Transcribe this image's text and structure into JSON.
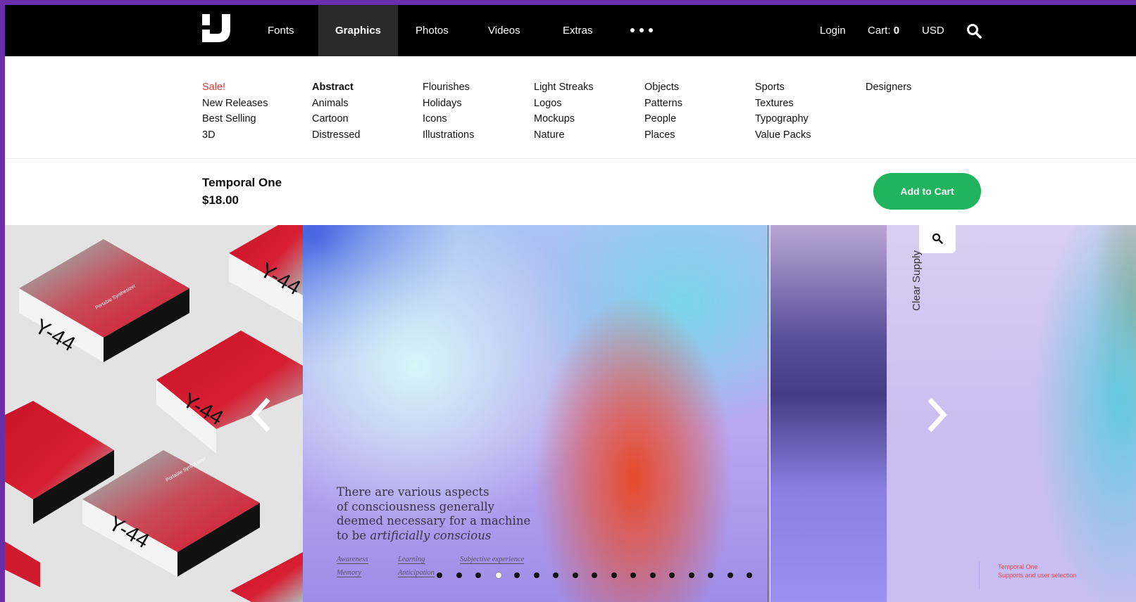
{
  "nav": {
    "links": [
      {
        "label": "Fonts",
        "active": false
      },
      {
        "label": "Graphics",
        "active": true
      },
      {
        "label": "Photos",
        "active": false
      },
      {
        "label": "Videos",
        "active": false
      },
      {
        "label": "Extras",
        "active": false
      }
    ],
    "login": "Login",
    "cart_label": "Cart:",
    "cart_count": "0",
    "currency": "USD"
  },
  "menu": {
    "col1": [
      "Sale!",
      "New Releases",
      "Best Selling",
      "3D"
    ],
    "col2": [
      "Abstract",
      "Animals",
      "Cartoon",
      "Distressed"
    ],
    "col3": [
      "Flourishes",
      "Holidays",
      "Icons",
      "Illustrations"
    ],
    "col4": [
      "Light Streaks",
      "Logos",
      "Mockups",
      "Nature"
    ],
    "col5": [
      "Objects",
      "Patterns",
      "People",
      "Places"
    ],
    "col6": [
      "Sports",
      "Textures",
      "Typography",
      "Value Packs"
    ],
    "col7": [
      "Designers"
    ]
  },
  "product": {
    "title": "Temporal One",
    "price": "$18.00",
    "add_to_cart": "Add to Cart"
  },
  "gallery": {
    "box_label": "Y-44",
    "box_sub": "Portable Synthesizer",
    "quote_lines": [
      "There are various aspects",
      "of consciousness generally",
      "deemed necessary for a machine",
      "to be "
    ],
    "quote_em": "artificially conscious",
    "tags": [
      "Awareness",
      "Learning",
      "Subjective experience",
      "Memory",
      "Anticipation"
    ],
    "side_label": "Clear Supply",
    "caption_lines": [
      "Temporal One",
      "Supports and user selection"
    ],
    "page_count": 17,
    "current_page": 4
  },
  "colors": {
    "accent_green": "#22b35e",
    "sale_red": "#e23a3a",
    "frame_purple": "#6a2fa8"
  },
  "icons": [
    "logo-icon",
    "more-dots-icon",
    "search-icon",
    "zoom-icon",
    "chevron-left-icon",
    "chevron-right-icon"
  ]
}
